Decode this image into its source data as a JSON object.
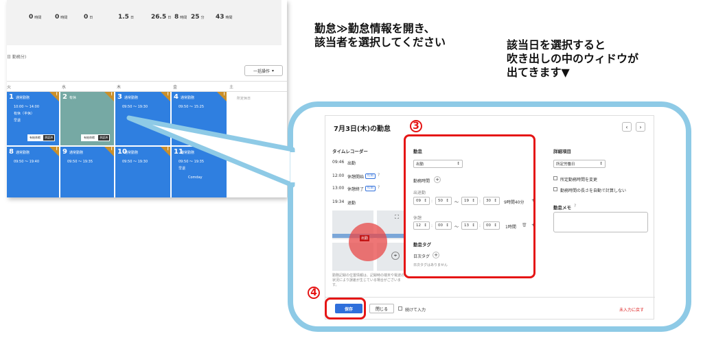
{
  "instructions": {
    "left_line1": "勤怠≫勤怠情報を開き、",
    "left_line2": "該当者を選択してください",
    "right_line1": "該当日を選択すると",
    "right_line2": "吹き出しの中のウィドウが",
    "right_line3": "出てきます▼"
  },
  "calendar": {
    "summary": [
      {
        "value": "0",
        "unit": "時間"
      },
      {
        "value": "0",
        "unit": "時間"
      },
      {
        "value": "0",
        "unit": "日"
      },
      {
        "value": "1.5",
        "unit": "日"
      },
      {
        "value": "26.5",
        "unit": "日"
      },
      {
        "value": "8",
        "unit": "時間"
      },
      {
        "value": "25",
        "unit": "分"
      },
      {
        "value": "43",
        "unit": "時間"
      }
    ],
    "sub_label": "日 勤務分)",
    "bulk_button": "一括操作",
    "days_of_week": [
      "火",
      "水",
      "木",
      "金",
      "土"
    ],
    "cells": {
      "c1": {
        "num": "1",
        "kind": "通常勤務",
        "l1": "10:00 〜 14:00",
        "l2": "有休（半休）",
        "l3": "早退",
        "btn1": "有給休暇",
        "btn2": "承認済"
      },
      "c2": {
        "num": "2",
        "kind": "有休",
        "btn1": "有給休暇",
        "btn2": "承認済"
      },
      "c3": {
        "num": "3",
        "kind": "通常勤務",
        "l1": "09:50 〜 19:30"
      },
      "c4": {
        "num": "4",
        "kind": "通常勤務",
        "l1": "09:50 〜 15:25"
      },
      "c8": {
        "num": "8",
        "kind": "通常勤務",
        "l1": "09:50 〜 19:40"
      },
      "c9": {
        "num": "9",
        "kind": "通常勤務",
        "l1": "09:50 〜 19:35"
      },
      "c10": {
        "num": "10",
        "kind": "通常勤務",
        "l1": "09:50 〜 19:30"
      },
      "c11": {
        "num": "11",
        "kind": "通常勤務",
        "l1": "09:50 〜 19:35",
        "l2": "早退",
        "l3": "Comday"
      }
    },
    "sat_text": "所定休日"
  },
  "modal": {
    "title": "7月3日(木)の勤怠",
    "time_recorder": {
      "heading": "タイムレコーダー",
      "entries": [
        {
          "time": "09:46",
          "label": "出勤"
        },
        {
          "time": "12:00",
          "label": "休憩開始",
          "badge": "打刻"
        },
        {
          "time": "13:00",
          "label": "休憩終了",
          "badge": "打刻"
        },
        {
          "time": "19:34",
          "label": "退勤"
        }
      ],
      "map_pin": "出勤",
      "map_note": "勤務記録の位置情報は、記録時の端末や電波の状況により誤差が生じている場合がございます。"
    },
    "attendance": {
      "heading": "勤怠",
      "type_select": "出勤",
      "work_time_label": "勤務時間",
      "clock_in_label": "出退勤",
      "work": {
        "h1": "09",
        "m1": "50",
        "sep": "〜",
        "h2": "19",
        "m2": "30",
        "duration": "9時間40分"
      },
      "break_label": "休憩",
      "break": {
        "h1": "12",
        "m1": "00",
        "sep": "〜",
        "h2": "13",
        "m2": "00",
        "duration": "1時間"
      },
      "tag_heading": "勤怠タグ",
      "daily_tag_label": "日次タグ",
      "daily_tag_empty": "日次タグはありません"
    },
    "details": {
      "heading": "詳細項目",
      "select": "所定労働日",
      "opt1": "所定勤務時間を変更",
      "opt2": "勤務時間の長さを自動で計算しない",
      "memo_heading": "勤怠メモ"
    },
    "footer": {
      "save": "保存",
      "close": "閉じる",
      "continue": "続けて入力",
      "reset": "未入力に戻す"
    }
  },
  "markers": {
    "m3": "3",
    "m4": "4"
  },
  "colors": {
    "accent": "#2f6fdb",
    "highlight": "#e51515",
    "callout": "#8ecae6",
    "cal_cell": "#2f7fe0"
  }
}
